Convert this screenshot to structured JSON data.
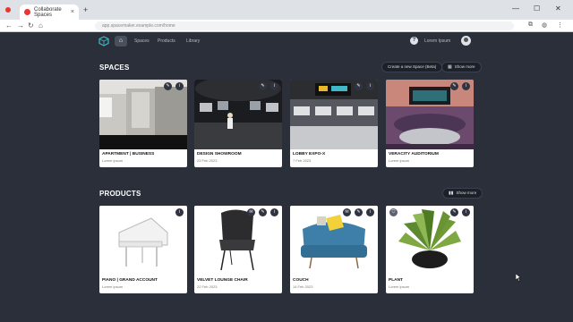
{
  "browser": {
    "tab_title": "Collaborate Spaces",
    "tab_close": "×",
    "new_tab": "+",
    "url": "app.spacemaker.example.com/home",
    "win_min": "—",
    "win_max": "☐",
    "win_close": "✕",
    "nav_back": "←",
    "nav_forward": "→",
    "nav_reload": "↻",
    "nav_home": "⌂"
  },
  "header": {
    "home_icon": "⌂",
    "nav": [
      "Spaces",
      "Products",
      "Library"
    ],
    "help": "?",
    "user_name": "Lorem Ipsum"
  },
  "spaces": {
    "title": "SPACES",
    "create_label": "Create a new Space (Beta)",
    "view_label": "Show more",
    "view_icon": "▦",
    "items": [
      {
        "name": "APARTMENT | BUSINESS",
        "date": "Lorem ipsum"
      },
      {
        "name": "DESIGN SHOWROOM",
        "date": "23 Feb 2023"
      },
      {
        "name": "LOBBY EXPO-X",
        "date": "7 Feb 2023"
      },
      {
        "name": "VERACITY AUDITORIUM",
        "date": "Lorem ipsum"
      }
    ]
  },
  "products": {
    "title": "PRODUCTS",
    "view_label": "Show more",
    "view_icon": "▮▮",
    "items": [
      {
        "name": "PIANO | GRAND ACCOUNT",
        "date": "Lorem ipsum"
      },
      {
        "name": "VELVET LOUNGE CHAIR",
        "date": "22 Feb 2023"
      },
      {
        "name": "COUCH",
        "date": "14 Feb 2023"
      },
      {
        "name": "PLANT",
        "date": "Lorem ipsum"
      }
    ]
  },
  "icons": {
    "edit": "✎",
    "info": "i",
    "chat": "✉",
    "shield": "⛉"
  },
  "colors": {
    "page_bg": "#2a2f3a",
    "card_bg": "#ffffff",
    "icon_bg": "#2f3440"
  }
}
